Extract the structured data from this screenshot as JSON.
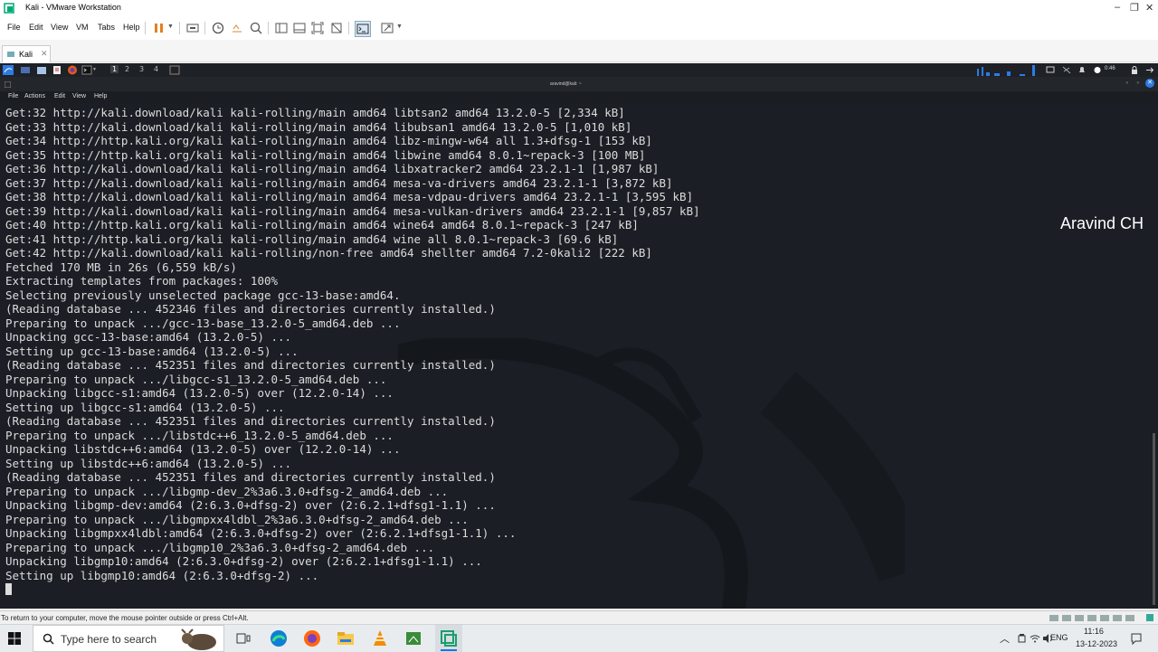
{
  "window": {
    "title": "Kali - VMware Workstation"
  },
  "menu": {
    "items": [
      "File",
      "Edit",
      "View",
      "VM",
      "Tabs",
      "Help"
    ]
  },
  "tabs": [
    {
      "label": "Kali"
    }
  ],
  "kali_panel": {
    "workspaces": [
      "1",
      "2",
      "3",
      "4"
    ],
    "clock": "0:46"
  },
  "terminal": {
    "title": "aravind@kali: ~",
    "menu": [
      "File",
      "Actions",
      "Edit",
      "View",
      "Help"
    ],
    "lines": [
      "Get:32 http://kali.download/kali kali-rolling/main amd64 libtsan2 amd64 13.2.0-5 [2,334 kB]",
      "Get:33 http://kali.download/kali kali-rolling/main amd64 libubsan1 amd64 13.2.0-5 [1,010 kB]",
      "Get:34 http://http.kali.org/kali kali-rolling/main amd64 libz-mingw-w64 all 1.3+dfsg-1 [153 kB]",
      "Get:35 http://http.kali.org/kali kali-rolling/main amd64 libwine amd64 8.0.1~repack-3 [100 MB]",
      "Get:36 http://kali.download/kali kali-rolling/main amd64 libxatracker2 amd64 23.2.1-1 [1,987 kB]",
      "Get:37 http://kali.download/kali kali-rolling/main amd64 mesa-va-drivers amd64 23.2.1-1 [3,872 kB]",
      "Get:38 http://kali.download/kali kali-rolling/main amd64 mesa-vdpau-drivers amd64 23.2.1-1 [3,595 kB]",
      "Get:39 http://kali.download/kali kali-rolling/main amd64 mesa-vulkan-drivers amd64 23.2.1-1 [9,857 kB]",
      "Get:40 http://http.kali.org/kali kali-rolling/main amd64 wine64 amd64 8.0.1~repack-3 [247 kB]",
      "Get:41 http://http.kali.org/kali kali-rolling/main amd64 wine all 8.0.1~repack-3 [69.6 kB]",
      "Get:42 http://kali.download/kali kali-rolling/non-free amd64 shellter amd64 7.2-0kali2 [222 kB]",
      "Fetched 170 MB in 26s (6,559 kB/s)",
      "Extracting templates from packages: 100%",
      "Selecting previously unselected package gcc-13-base:amd64.",
      "(Reading database ... 452346 files and directories currently installed.)",
      "Preparing to unpack .../gcc-13-base_13.2.0-5_amd64.deb ...",
      "Unpacking gcc-13-base:amd64 (13.2.0-5) ...",
      "Setting up gcc-13-base:amd64 (13.2.0-5) ...",
      "(Reading database ... 452351 files and directories currently installed.)",
      "Preparing to unpack .../libgcc-s1_13.2.0-5_amd64.deb ...",
      "Unpacking libgcc-s1:amd64 (13.2.0-5) over (12.2.0-14) ...",
      "Setting up libgcc-s1:amd64 (13.2.0-5) ...",
      "(Reading database ... 452351 files and directories currently installed.)",
      "Preparing to unpack .../libstdc++6_13.2.0-5_amd64.deb ...",
      "Unpacking libstdc++6:amd64 (13.2.0-5) over (12.2.0-14) ...",
      "Setting up libstdc++6:amd64 (13.2.0-5) ...",
      "(Reading database ... 452351 files and directories currently installed.)",
      "Preparing to unpack .../libgmp-dev_2%3a6.3.0+dfsg-2_amd64.deb ...",
      "Unpacking libgmp-dev:amd64 (2:6.3.0+dfsg-2) over (2:6.2.1+dfsg1-1.1) ...",
      "Preparing to unpack .../libgmpxx4ldbl_2%3a6.3.0+dfsg-2_amd64.deb ...",
      "Unpacking libgmpxx4ldbl:amd64 (2:6.3.0+dfsg-2) over (2:6.2.1+dfsg1-1.1) ...",
      "Preparing to unpack .../libgmp10_2%3a6.3.0+dfsg-2_amd64.deb ...",
      "Unpacking libgmp10:amd64 (2:6.3.0+dfsg-2) over (2:6.2.1+dfsg1-1.1) ...",
      "Setting up libgmp10:amd64 (2:6.3.0+dfsg-2) ..."
    ]
  },
  "watermark": "Aravind CH",
  "statusbar": {
    "hint": "To return to your computer, move the mouse pointer outside or press Ctrl+Alt."
  },
  "taskbar": {
    "search_placeholder": "Type here to search",
    "language": "ENG",
    "time": "11:16",
    "date": "13-12-2023"
  },
  "colors": {
    "terminal_bg": "#1b1e24",
    "terminal_fg": "#dcdcdc",
    "taskbar_bg": "#e8ecef"
  }
}
